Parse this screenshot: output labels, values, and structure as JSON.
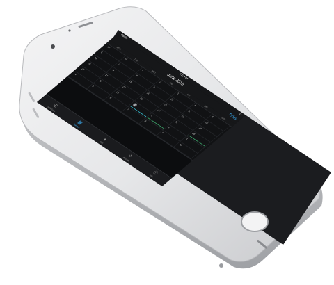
{
  "status_bar": {
    "carrier": "Carrier",
    "time": "4:32 PM"
  },
  "nav": {
    "title": "June 2016",
    "today_label": "Today"
  },
  "weekdays": [
    "MON",
    "TUE",
    "WED",
    "THU",
    "FRI",
    "SAT",
    "SUN"
  ],
  "calendar": {
    "selected_day": "30",
    "weeks": [
      [
        "30",
        "31",
        "1",
        "2",
        "3",
        "4",
        "5"
      ],
      [
        "6",
        "7",
        "8",
        "9",
        "10",
        "11",
        "12"
      ],
      [
        "13",
        "14",
        "15",
        "16",
        "17",
        "18",
        "19"
      ],
      [
        "20",
        "21",
        "22",
        "23",
        "24",
        "25",
        "26"
      ],
      [
        "27",
        "28",
        "29",
        "30",
        "1",
        "2",
        "3"
      ],
      [
        "4",
        "5",
        "6",
        "7",
        "8",
        "9",
        "10"
      ]
    ]
  },
  "tabs": [
    {
      "label": "Schedules",
      "icon": "list-icon"
    },
    {
      "label": "Planner",
      "icon": "calendar-icon"
    },
    {
      "label": "Stat",
      "icon": "box-icon"
    },
    {
      "label": "Aircrafts",
      "icon": "airplane-icon"
    },
    {
      "label": "Info",
      "icon": "info-icon"
    }
  ],
  "colors": {
    "accent": "#3aa6e8",
    "event_primary": "#33b5c8",
    "event_secondary": "#3ea36a",
    "screen_bg": "#111214"
  }
}
